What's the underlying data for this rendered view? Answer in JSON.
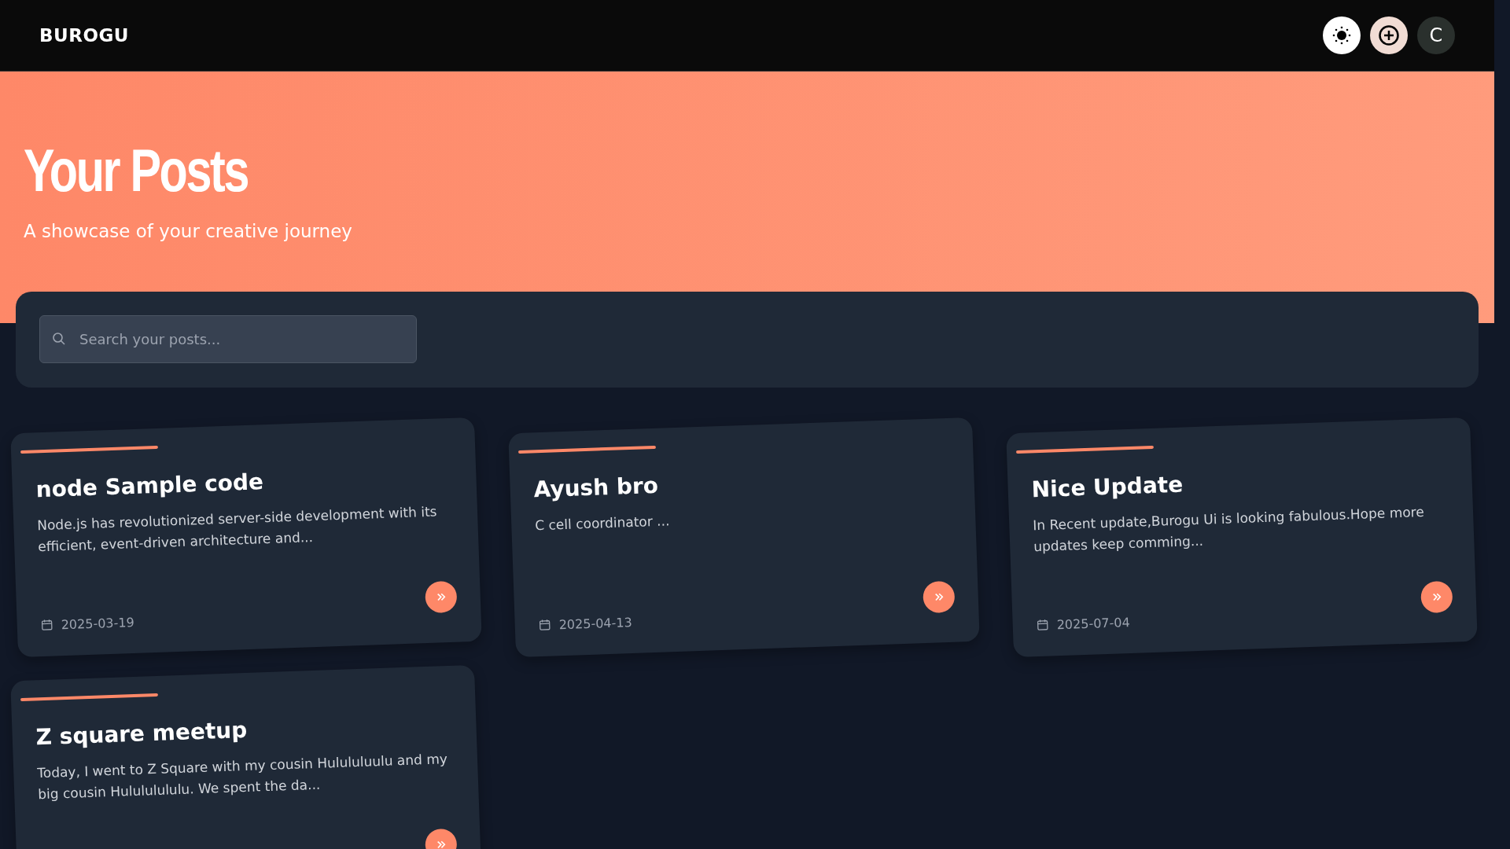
{
  "header": {
    "logo": "BUROGU",
    "avatar_initial": "C"
  },
  "hero": {
    "title": "Your Posts",
    "subtitle": "A showcase of your creative journey"
  },
  "search": {
    "placeholder": "Search your posts..."
  },
  "posts": [
    {
      "title": "node Sample code",
      "excerpt": "Node.js has revolutionized server-side development with its efficient, event-driven architecture and...",
      "date": "2025-03-19"
    },
    {
      "title": "Ayush bro",
      "excerpt": "C cell coordinator ...",
      "date": "2025-04-13"
    },
    {
      "title": "Nice Update",
      "excerpt": "In Recent update,Burogu Ui is looking fabulous.Hope more updates keep comming...",
      "date": "2025-07-04"
    },
    {
      "title": "Z square meetup",
      "excerpt": "Today, I went to Z Square with my cousin Hulululuulu and my big cousin Hulululululu. We spent the da..."
    }
  ]
}
